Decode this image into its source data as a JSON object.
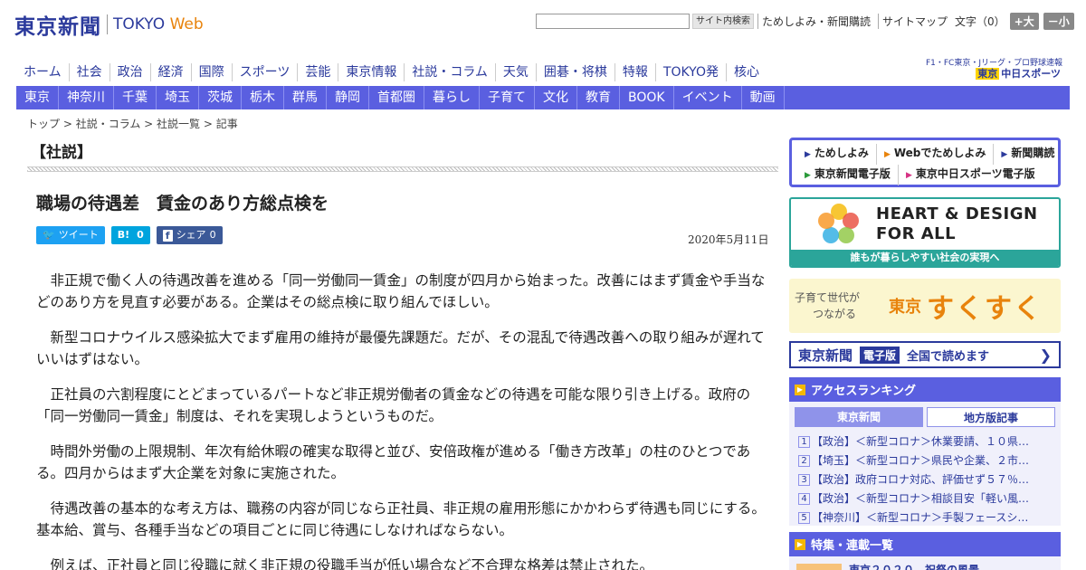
{
  "header": {
    "logo_jp": "東京新聞",
    "logo_en": "TOKYO",
    "logo_web": "Web",
    "search_placeholder": "",
    "search_button": "サイト内検索",
    "links": [
      "ためしよみ・新聞購読",
      "サイトマップ"
    ],
    "font_size_label": "文字（0）",
    "size_up": "+大",
    "size_down": "－小"
  },
  "main_nav": [
    "ホーム",
    "社会",
    "政治",
    "経済",
    "国際",
    "スポーツ",
    "芸能",
    "東京情報",
    "社説・コラム",
    "天気",
    "囲碁・将棋",
    "特報",
    "TOKYO発",
    "核心"
  ],
  "chunichi": {
    "line1": "F1・FC東京・Jリーグ・プロ野球速報",
    "line2_prefix": "東京",
    "line2": "中日スポーツ"
  },
  "sub_nav": [
    "東京",
    "神奈川",
    "千葉",
    "埼玉",
    "茨城",
    "栃木",
    "群馬",
    "静岡",
    "首都圏",
    "暮らし",
    "子育て",
    "文化",
    "教育",
    "BOOK",
    "イベント",
    "動画"
  ],
  "breadcrumb": {
    "items": [
      "トップ",
      "社説・コラム",
      "社説一覧",
      "記事"
    ],
    "separator": " > "
  },
  "article": {
    "section": "【社説】",
    "title": "職場の待遇差　賃金のあり方総点検を",
    "date": "2020年5月11日",
    "share": {
      "tweet": "ツイート",
      "hatena_label": "B!",
      "hatena_count": "0",
      "fb_label": "シェア",
      "fb_count": "0"
    },
    "paragraphs": [
      "非正規で働く人の待遇改善を進める「同一労働同一賃金」の制度が四月から始まった。改善にはまず賃金や手当などのあり方を見直す必要がある。企業はその総点検に取り組んでほしい。",
      "新型コロナウイルス感染拡大でまず雇用の維持が最優先課題だ。だが、その混乱で待遇改善への取り組みが遅れていいはずはない。",
      "正社員の六割程度にとどまっているパートなど非正規労働者の賃金などの待遇を可能な限り引き上げる。政府の「同一労働同一賃金」制度は、それを実現しようというものだ。",
      "時間外労働の上限規制、年次有給休暇の確実な取得と並び、安倍政権が進める「働き方改革」の柱のひとつである。四月からはまず大企業を対象に実施された。",
      "待遇改善の基本的な考え方は、職務の内容が同じなら正社員、非正規の雇用形態にかかわらず待遇も同じにする。基本給、賞与、各種手当などの項目ごとに同じ待遇にしなければならない。",
      "例えば、正社員と同じ役職に就く非正規の役職手当が低い場合など不合理な格差は禁止された。"
    ]
  },
  "sidebar": {
    "promo": {
      "row1": [
        "ためしよみ",
        "Webでためしよみ",
        "新聞購読"
      ],
      "row2": [
        "東京新聞電子版",
        "東京中日スポーツ電子版"
      ]
    },
    "heart": {
      "line1": "HEART & DESIGN",
      "line2": "FOR ALL",
      "footer": "誰もが暮らしやすい社会の実現へ"
    },
    "sukusuku": {
      "small_line1": "子育て世代が",
      "small_line2": "つながる",
      "tokyo": "東京",
      "big": "すくすく"
    },
    "epaper": {
      "brand": "東京新聞",
      "tag": "電子版",
      "text": "全国で読めます"
    },
    "ranking": {
      "title": "アクセスランキング",
      "tab_on": "東京新聞",
      "tab_off": "地方版記事",
      "items": [
        {
          "n": "1",
          "text": "【政治】＜新型コロナ＞休業要請、１０県…"
        },
        {
          "n": "2",
          "text": "【埼玉】＜新型コロナ＞県民や企業、２市…"
        },
        {
          "n": "3",
          "text": "【政治】政府コロナ対応、評価せず５７％…"
        },
        {
          "n": "4",
          "text": "【政治】＜新型コロナ＞相談目安「軽い風…"
        },
        {
          "n": "5",
          "text": "【神奈川】＜新型コロナ＞手製フェースシ…"
        }
      ]
    },
    "feature": {
      "title": "特集・連載一覧",
      "first_item": "東京２０２０　祝祭の風景"
    }
  }
}
